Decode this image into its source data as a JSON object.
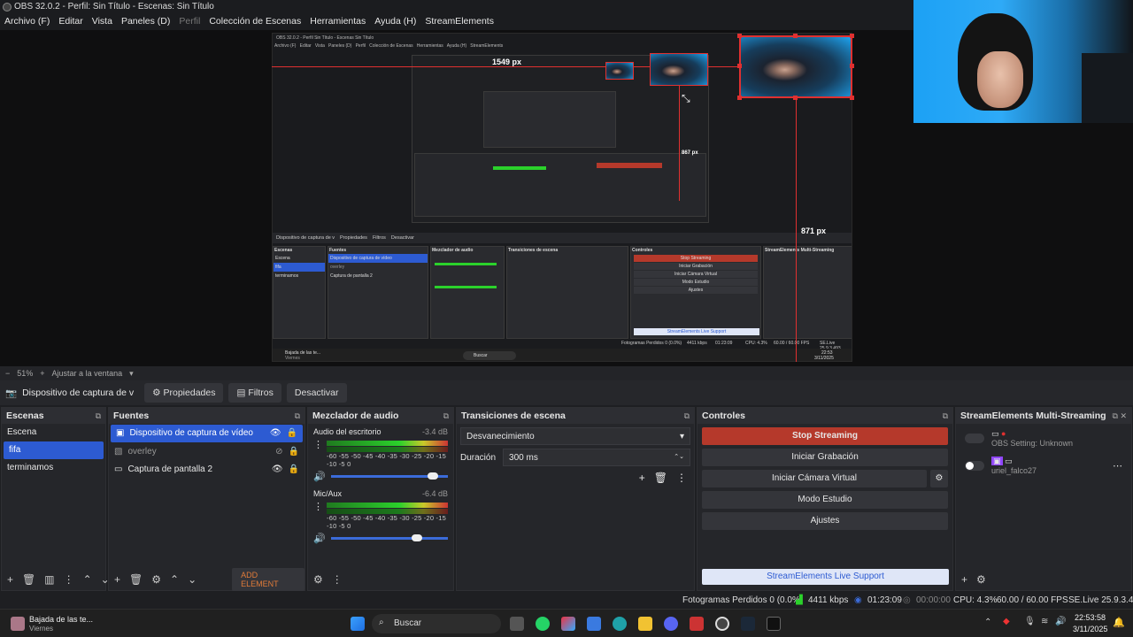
{
  "window": {
    "title": "OBS 32.0.2 - Perfil: Sin Título - Escenas: Sin Título"
  },
  "menu": [
    "Archivo (F)",
    "Editar",
    "Vista",
    "Paneles (D)",
    "Perfil",
    "Colección de Escenas",
    "Herramientas",
    "Ayuda (H)",
    "StreamElements"
  ],
  "preview": {
    "measure_top": "1549 px",
    "measure_right": "871 px",
    "measure_small": "867 px",
    "nested_title": "OBS 32.0.2 - Perfil Sin Título - Escenas Sin Título",
    "nested_menu": "Archivo (F)   Editar   Vista   Paneles (D)   Perfil   Colección de Escenas   Herramientas   Ayuda (H)   StreamElements",
    "nested_srcbar": [
      "Dispositivo de captura de v",
      "Propiedades",
      "Filtros",
      "Desactivar"
    ],
    "nested_headers": [
      "Escenas",
      "Fuentes",
      "Mezclador de audio",
      "Transiciones de escena",
      "Controles",
      "StreamElements Multi-Streaming"
    ],
    "nested_scenes": [
      "Escena",
      "fifa",
      "terminamos"
    ],
    "nested_sources": [
      "Dispositivo de captura de vídeo",
      "overley",
      "Captura de pantalla 2"
    ],
    "nested_controls": [
      "Stop Streaming",
      "Iniciar Grabación",
      "Iniciar Cámara Virtual",
      "Modo Estudio",
      "Ajustes"
    ],
    "nested_support": "StreamElements Live Support",
    "nested_status": "Fotogramas Perdidos 0 (0.0%)",
    "nested_kbps": "4411 kbps",
    "nested_time": "01:23:09",
    "nested_cpu": "CPU: 4.3%",
    "nested_fps": "60.00 / 60.00 FPS",
    "nested_se": "SE.Live 25.9.3.493",
    "nested_taskbar_search": "Buscar",
    "nested_taskbar_time": "22:53",
    "nested_taskbar_date": "3/11/2025",
    "nested_taskbar_app": "Bajada de las te...",
    "nested_taskbar_sub": "Viernes"
  },
  "zoombar": {
    "minus": "−",
    "zoom": "51%",
    "plus": "+",
    "fit": "Ajustar a la ventana"
  },
  "srcbar": {
    "source": "Dispositivo de captura de v",
    "properties": "Propiedades",
    "filters": "Filtros",
    "deactivate": "Desactivar"
  },
  "scenes": {
    "title": "Escenas",
    "items": [
      "Escena",
      "fifa",
      "terminamos"
    ],
    "selected": "fifa"
  },
  "sources": {
    "title": "Fuentes",
    "items": [
      "Dispositivo de captura de vídeo",
      "overley",
      "Captura de pantalla 2"
    ],
    "add": "ADD ELEMENT"
  },
  "mixer": {
    "title": "Mezclador de audio",
    "channels": [
      {
        "name": "Audio del escritorio",
        "db": "-3.4 dB",
        "scale": "-60 -55 -50 -45 -40 -35 -30 -25 -20 -15 -10 -5 0",
        "volume": 0.92
      },
      {
        "name": "Mic/Aux",
        "db": "-6.4 dB",
        "scale": "-60 -55 -50 -45 -40 -35 -30 -25 -20 -15 -10 -5 0",
        "volume": 0.78
      }
    ]
  },
  "transitions": {
    "title": "Transiciones de escena",
    "selected": "Desvanecimiento",
    "duration_label": "Duración",
    "duration": "300 ms"
  },
  "controls": {
    "title": "Controles",
    "buttons": [
      "Stop Streaming",
      "Iniciar Grabación",
      "Iniciar Cámara Virtual",
      "Modo Estudio",
      "Ajustes"
    ],
    "support": "StreamElements Live Support"
  },
  "multistream": {
    "title": "StreamElements Multi-Streaming",
    "rows": [
      "OBS Setting: Unknown",
      "uriel_falco27"
    ]
  },
  "status": {
    "dropped": "Fotogramas Perdidos 0 (0.0%)",
    "kbps": "4411 kbps",
    "time": "01:23:09",
    "rec_time": "00:00:00",
    "cpu": "CPU: 4.3%",
    "fps": "60.00 / 60.00 FPS",
    "se": "SE.Live 25.9.3.493"
  },
  "taskbar": {
    "app_title": "Bajada de las te...",
    "app_sub": "Viernes",
    "search": "Buscar",
    "time": "22:53:58",
    "date": "3/11/2025"
  },
  "colors": {
    "accent": "#2d5bd2",
    "stop": "#b5392b",
    "selection_red": "#e03030"
  }
}
